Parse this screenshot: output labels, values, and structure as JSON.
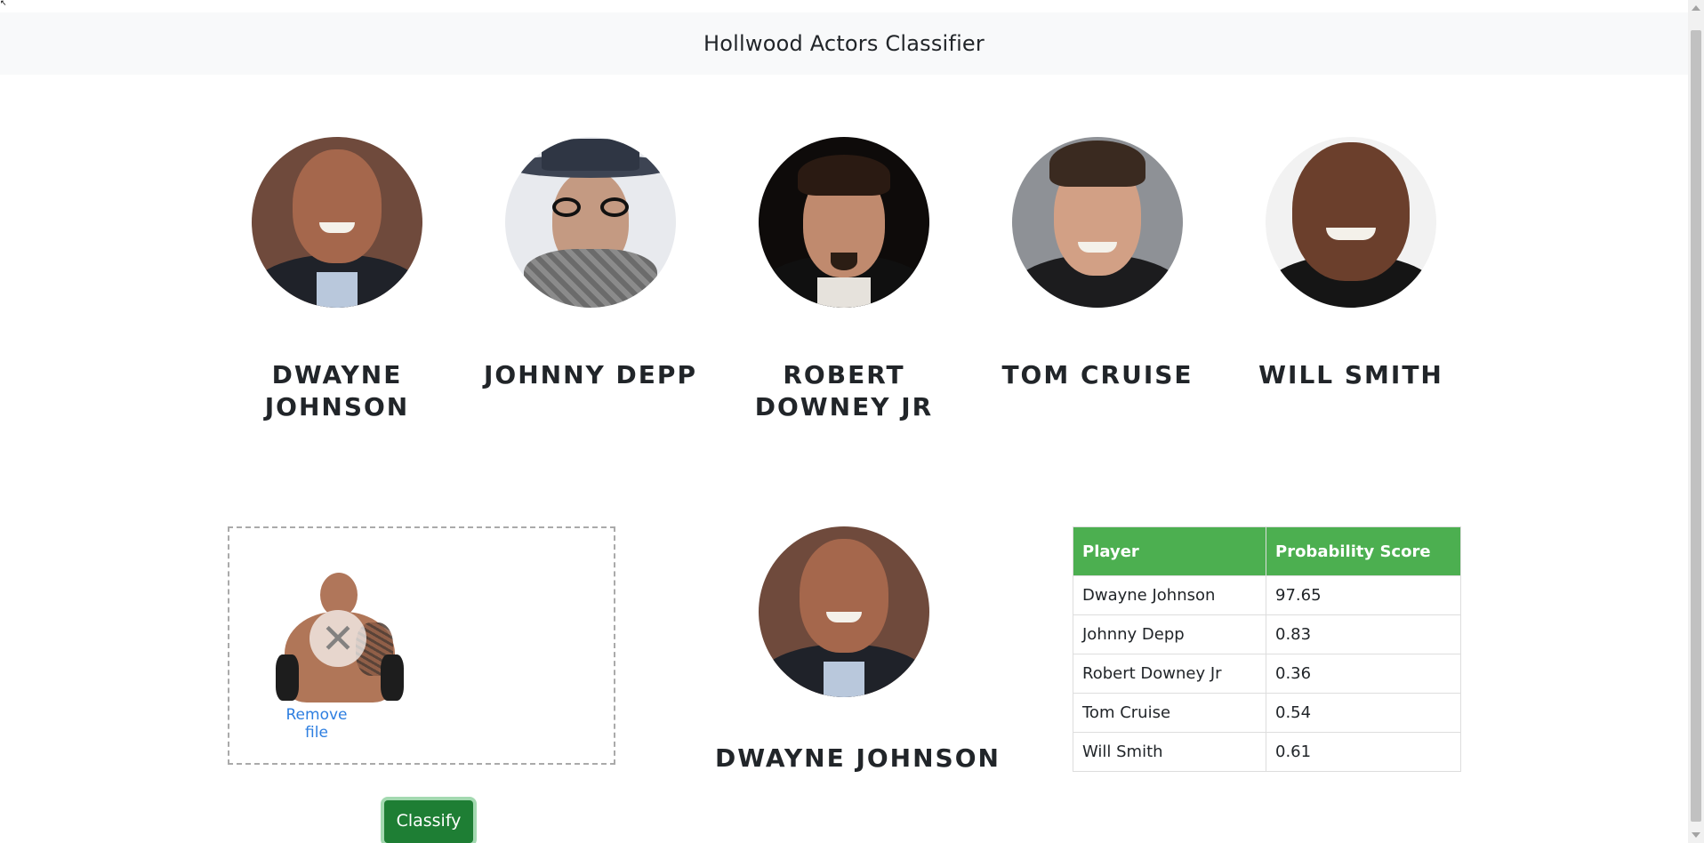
{
  "navbar": {
    "title": "Hollwood Actors Classifier"
  },
  "actors": [
    {
      "name": "DWAYNE JOHNSON"
    },
    {
      "name": "JOHNNY DEPP"
    },
    {
      "name": "ROBERT DOWNEY JR"
    },
    {
      "name": "TOM CRUISE"
    },
    {
      "name": "WILL SMITH"
    }
  ],
  "dropzone": {
    "remove_label": "Remove file",
    "remove_icon": "close-icon"
  },
  "classify_button": {
    "label": "Classify",
    "color": "#1e7e34"
  },
  "result": {
    "name": "DWAYNE JOHNSON"
  },
  "score_table": {
    "header_color": "#4caf50",
    "headers": [
      "Player",
      "Probability Score"
    ],
    "rows": [
      [
        "Dwayne Johnson",
        "97.65"
      ],
      [
        "Johnny Depp",
        "0.83"
      ],
      [
        "Robert Downey Jr",
        "0.36"
      ],
      [
        "Tom Cruise",
        "0.54"
      ],
      [
        "Will Smith",
        "0.61"
      ]
    ]
  }
}
